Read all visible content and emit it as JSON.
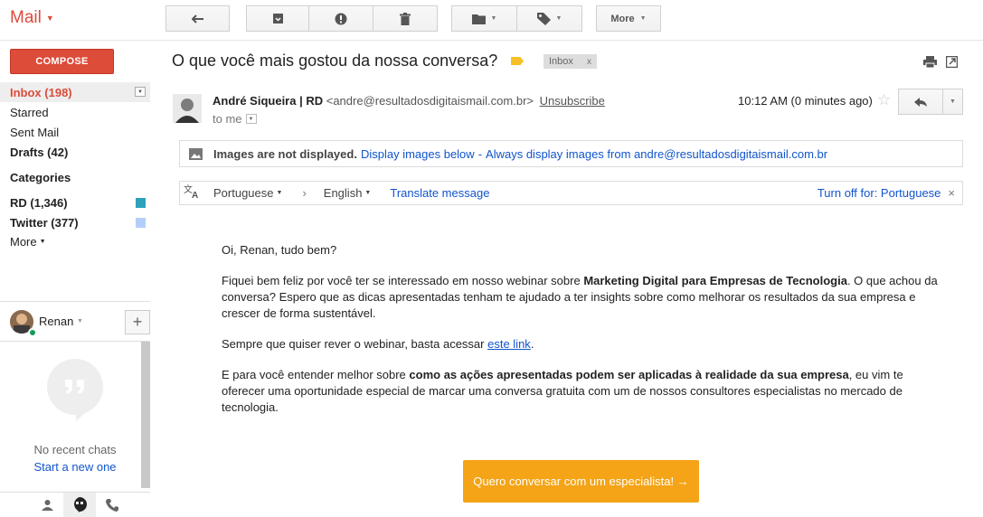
{
  "app": {
    "title": "Mail"
  },
  "toolbar": {
    "more_label": "More"
  },
  "sidebar": {
    "compose_label": "COMPOSE",
    "items": [
      {
        "label": "Inbox (198)"
      },
      {
        "label": "Starred"
      },
      {
        "label": "Sent Mail"
      },
      {
        "label": "Drafts (42)"
      },
      {
        "label": "Categories"
      },
      {
        "label": "RD (1,346)",
        "color": "#2da2bb"
      },
      {
        "label": "Twitter (377)",
        "color": "#b3cefb"
      },
      {
        "label": "More"
      }
    ]
  },
  "chat": {
    "user_name": "Renan",
    "no_recent": "No recent chats",
    "start_new": "Start a new one"
  },
  "message": {
    "subject": "O que você mais gostou da nossa conversa?",
    "label_chip": "Inbox",
    "label_chip_close": "x",
    "sender_name": "André Siqueira | RD",
    "sender_email": "<andre@resultadosdigitaismail.com.br>",
    "unsubscribe": "Unsubscribe",
    "to": "to me",
    "timestamp": "10:12 AM (0 minutes ago)"
  },
  "images_banner": {
    "notice": "Images are not displayed.",
    "display_below": "Display images below",
    "separator": "-",
    "always_display": "Always display images from andre@resultadosdigitaismail.com.br"
  },
  "translate": {
    "from_lang": "Portuguese",
    "to_lang": "English",
    "translate_link": "Translate message",
    "turn_off": "Turn off for: Portuguese",
    "close": "×"
  },
  "body": {
    "greeting": "Oi, Renan, tudo bem?",
    "p1_a": "Fiquei bem feliz por você ter se interessado em nosso webinar sobre ",
    "p1_bold": "Marketing Digital para Empresas de Tecnologia",
    "p1_b": ". O que achou da conversa? Espero que as dicas apresentadas tenham te ajudado a ter insights sobre como melhorar os resultados da sua empresa e crescer de forma sustentável.",
    "p2_a": "Sempre que quiser rever o webinar, basta acessar ",
    "p2_link": "este link",
    "p2_b": ".",
    "p3_a": "E para você entender melhor sobre ",
    "p3_bold": "como as ações apresentadas podem ser aplicadas à realidade da sua empresa",
    "p3_b": ", eu vim te oferecer uma oportunidade especial de marcar uma conversa gratuita com um de nossos consultores especialistas no mercado de tecnologia.",
    "cta": "Quero conversar com um especialista! →"
  }
}
